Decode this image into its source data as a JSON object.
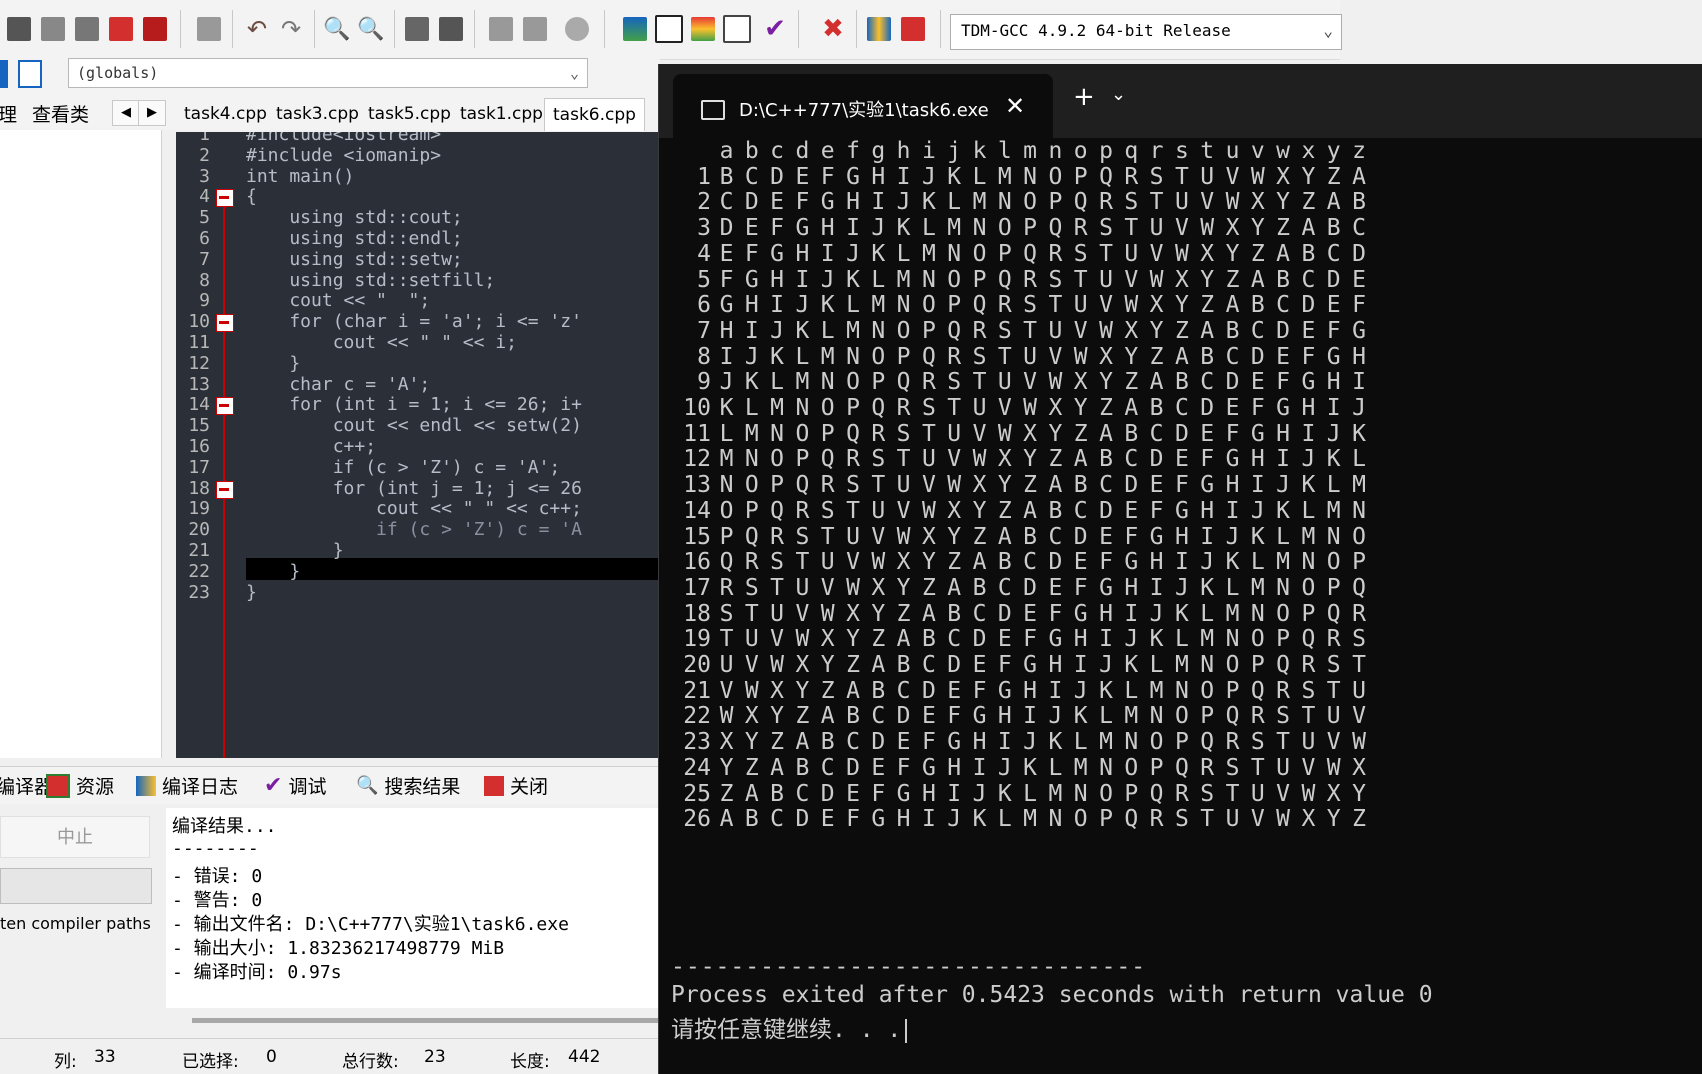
{
  "toolbar": {
    "compiler": "TDM-GCC 4.9.2 64-bit Release",
    "colors": {
      "red": "#d32f2f",
      "green": "#2e7d32",
      "blue": "#1565c0",
      "purple": "#7b1fa2"
    }
  },
  "scope": {
    "value": "(globals)"
  },
  "left_tabs": {
    "project": "理",
    "classes": "查看类"
  },
  "file_tabs": [
    "task4.cpp",
    "task3.cpp",
    "task5.cpp",
    "task1.cpp",
    "task6.cpp"
  ],
  "active_file": "task6.cpp",
  "editor": {
    "lines": [
      "#include<iostream>",
      "#include <iomanip>",
      "int main()",
      "{",
      "    using std::cout;",
      "    using std::endl;",
      "    using std::setw;",
      "    using std::setfill;",
      "    cout << \"  \";",
      "    for (char i = 'a'; i <= 'z'",
      "        cout << \" \" << i;",
      "    }",
      "    char c = 'A';",
      "    for (int i = 1; i <= 26; i+",
      "        cout << endl << setw(2)",
      "        c++;",
      "        if (c > 'Z') c = 'A';",
      "        for (int j = 1; j <= 26",
      "            cout << \" \" << c++;",
      "            if (c > 'Z') c = 'A",
      "        }",
      "    }",
      "}"
    ],
    "fold_lines": [
      4,
      10,
      14,
      18
    ],
    "highlight_line": 20
  },
  "bottom_tabs": [
    "编译器",
    "资源",
    "编译日志",
    "调试",
    "搜索结果",
    "关闭"
  ],
  "stop_label": "中止",
  "path_check": "ten compiler paths",
  "log": [
    "编译结果...",
    "--------",
    "- 错误: 0",
    "- 警告: 0",
    "- 输出文件名: D:\\C++777\\实验1\\task6.exe",
    "- 输出大小: 1.83236217498779 MiB",
    "- 编译时间: 0.97s"
  ],
  "status": {
    "col_label": "列:",
    "col_value": "33",
    "sel_label": "已选择:",
    "sel_value": "0",
    "lines_label": "总行数:",
    "lines_value": "23",
    "len_label": "长度:",
    "len_value": "442"
  },
  "terminal": {
    "title": "D:\\C++777\\实验1\\task6.exe",
    "header": "abcdefghijklmnopqrstuvwxyz",
    "row_count": 26,
    "dashes": "--------------------------------",
    "process_line": "Process exited after 0.5423 seconds with return value 0",
    "press_key": "请按任意键继续. . ."
  }
}
